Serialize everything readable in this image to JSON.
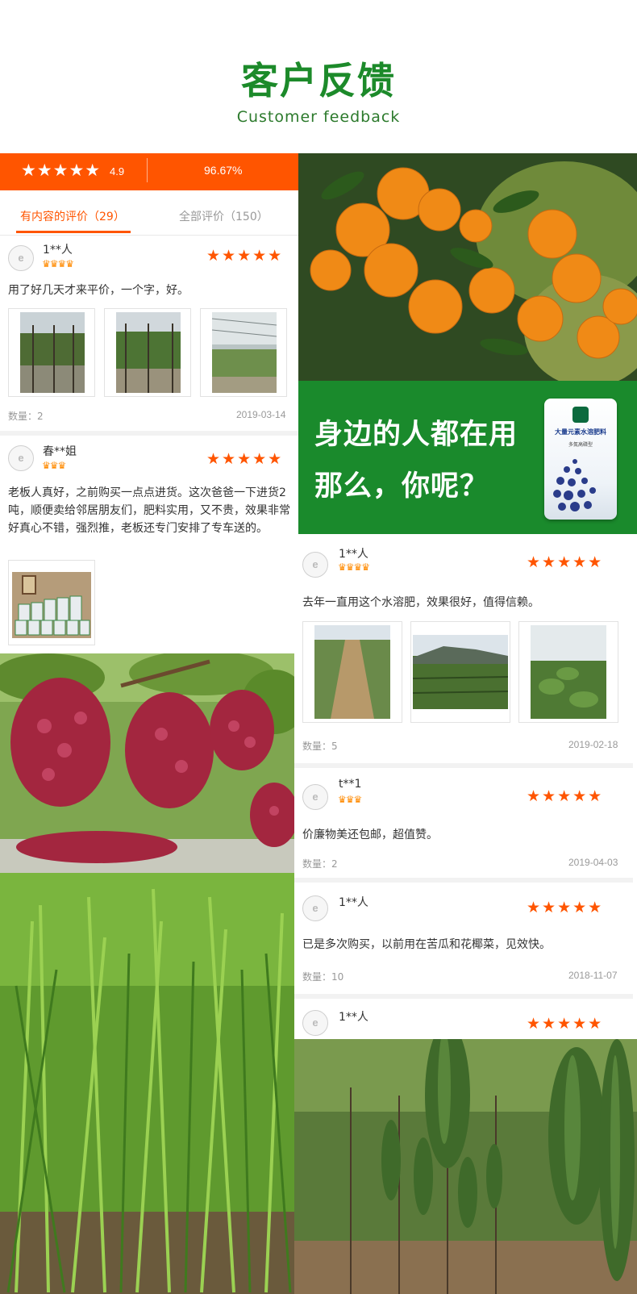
{
  "header": {
    "title": "客户反馈",
    "subtitle": "Customer feedback"
  },
  "summary": {
    "stars": "★★★★★",
    "score": "4.9",
    "positive_rate": "96.67%"
  },
  "tabs": [
    {
      "label": "有内容的评价（29）"
    },
    {
      "label": "全部评价（150）"
    }
  ],
  "avatar_text": "e",
  "rating_stars": "★★★★★",
  "reviews_left": [
    {
      "user": "1**人",
      "crowns": "♛♛♛♛",
      "text": "用了好几天才来平价，一个字，好。",
      "count": "数量：2",
      "date": "2019-03-14"
    },
    {
      "user": "春**姐",
      "crowns": "♛♛♛",
      "text": "老板人真好，之前购买一点点进货。这次爸爸一下进货2吨，顺便卖给邻居朋友们，肥料实用，又不贵，效果非常好真心不错，强烈推，老板还专门安排了专车送的。"
    }
  ],
  "banner": {
    "line1": "身边的人都在用",
    "line2": "那么，你呢？",
    "product_name": "大量元素水溶肥料",
    "product_sub": "多氮高磷型"
  },
  "reviews_right": [
    {
      "user": "1**人",
      "crowns": "♛♛♛♛",
      "text": "去年一直用这个水溶肥，效果很好，值得信赖。",
      "count": "数量：5",
      "date": "2019-02-18"
    },
    {
      "user": "t**1",
      "crowns": "♛♛♛",
      "text": "价廉物美还包邮，超值赞。",
      "count": "数量：2",
      "date": "2019-04-03"
    },
    {
      "user": "1**人",
      "text": "已是多次购买，以前用在苦瓜和花椰菜，见效快。",
      "count": "数量：10",
      "date": "2018-11-07"
    },
    {
      "user": "1**人"
    }
  ],
  "colors": {
    "brand_green": "#1a8a2c",
    "accent_orange": "#ff5500"
  }
}
